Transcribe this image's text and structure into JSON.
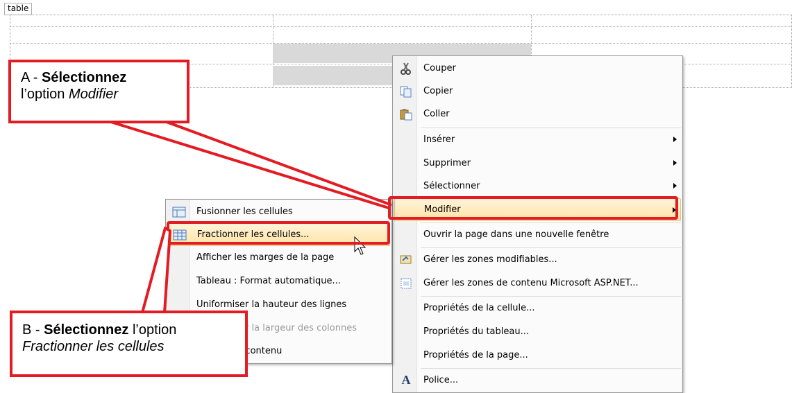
{
  "design_view": {
    "table_tag": "table"
  },
  "callouts": {
    "a": {
      "prefix": "A - ",
      "bold": "Sélectionnez",
      "line1_rest": "",
      "line2_plain": "l’option ",
      "line2_italic": "Modifier"
    },
    "b": {
      "prefix": "B - ",
      "bold": "Sélectionnez",
      "line1_rest": " l’option",
      "line2_italic": "Fractionner les cellules"
    }
  },
  "context_menu": {
    "items": [
      {
        "label": "Couper",
        "icon": "scissors-icon"
      },
      {
        "label": "Copier",
        "icon": "copy-icon"
      },
      {
        "label": "Coller",
        "icon": "paste-icon"
      },
      {
        "label": "Insérer",
        "submenu": true
      },
      {
        "label": "Supprimer",
        "submenu": true
      },
      {
        "label": "Sélectionner",
        "submenu": true
      },
      {
        "label": "Modifier",
        "submenu": true,
        "highlighted": true
      },
      {
        "label": "Ouvrir la page dans une nouvelle fenêtre"
      },
      {
        "label": "Gérer les zones modifiables...",
        "icon": "editable-regions-icon"
      },
      {
        "label": "Gérer les zones de contenu Microsoft ASP.NET...",
        "icon": "content-regions-icon"
      },
      {
        "label": "Propriétés de la cellule..."
      },
      {
        "label": "Propriétés du tableau..."
      },
      {
        "label": "Propriétés de la page..."
      },
      {
        "label": "Police...",
        "icon": "font-icon"
      }
    ]
  },
  "submenu": {
    "items": [
      {
        "label": "Fusionner les cellules",
        "icon": "merge-cells-icon"
      },
      {
        "label": "Fractionner les cellules...",
        "icon": "split-cells-icon",
        "highlighted": true
      },
      {
        "label": "Afficher les marges de la page"
      },
      {
        "label": "Tableau : Format automatique..."
      },
      {
        "label": "Uniformiser la hauteur des lignes"
      },
      {
        "label": "Uniformiser la largeur des colonnes",
        "disabled": true
      },
      {
        "label": "Ajuster au contenu"
      }
    ]
  },
  "colors": {
    "accent_red": "#e31b23",
    "highlight": "#ffe3a6"
  }
}
